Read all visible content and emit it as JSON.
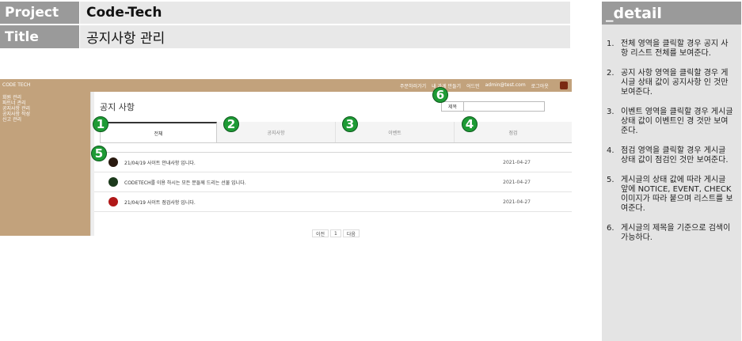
{
  "header": {
    "project_label": "Project",
    "project_value": "Code-Tech",
    "title_label": "Title",
    "title_value": "공지사항 관리"
  },
  "app": {
    "brand": "CODE TECH",
    "top_menu": [
      "주문하러가기",
      "내 가게 만들기",
      "어드민",
      "admin@test.com",
      "로그아웃"
    ],
    "sidebar_items": [
      "회원 관리",
      "파트너 관리",
      "공지사항 관리",
      "공지사항 작성",
      "신고 관리"
    ],
    "page_title": "공지 사항",
    "search_label": "제목",
    "search_value": "",
    "tabs": [
      "전체",
      "공지사항",
      "이벤트",
      "점검"
    ],
    "posts": [
      {
        "type": "NOTICE",
        "title": "21/04/19 사이트 안내사항 입니다.",
        "date": "2021-04-27",
        "color": "#2a1a10"
      },
      {
        "type": "EVENT",
        "title": "CODETECH를 이용 하시는 모든 분들께 드리는 선물 입니다.",
        "date": "2021-04-27",
        "color": "#1c3a1c"
      },
      {
        "type": "CHECK",
        "title": "21/04/19 사이트 점검사항 입니다.",
        "date": "2021-04-27",
        "color": "#b01818"
      }
    ],
    "pagination": {
      "prev": "이전",
      "current": "1",
      "next": "다음"
    }
  },
  "markers": [
    "1",
    "2",
    "3",
    "4",
    "5",
    "6"
  ],
  "panel": {
    "title": "_detail",
    "items": [
      {
        "num": "1.",
        "text": "전체 영역을 클릭할 경우 공지 사항 리스트 전체를 보여준다."
      },
      {
        "num": "2.",
        "text": "공지 사항 영역을 클릭할 경우 게시글 상태 값이 공지사항 인 것만 보여준다."
      },
      {
        "num": "3.",
        "text": "이벤트 영역을 클릭할 경우 게시글 상태 값이 이벤트인 경 것만 보여준다."
      },
      {
        "num": "4.",
        "text": "점검 영역을 클릭할 경우 게시글 상태 값이 점검인 것만 보여준다."
      },
      {
        "num": "5.",
        "text": "게시글의 상태 값에 따라 게시글 앞에 NOTICE, EVENT, CHECK 이미지가 따라 붙으며 리스트를 보여준다."
      },
      {
        "num": "6.",
        "text": "게시글의 제목을 기준으로 검색이 가능하다."
      }
    ]
  }
}
